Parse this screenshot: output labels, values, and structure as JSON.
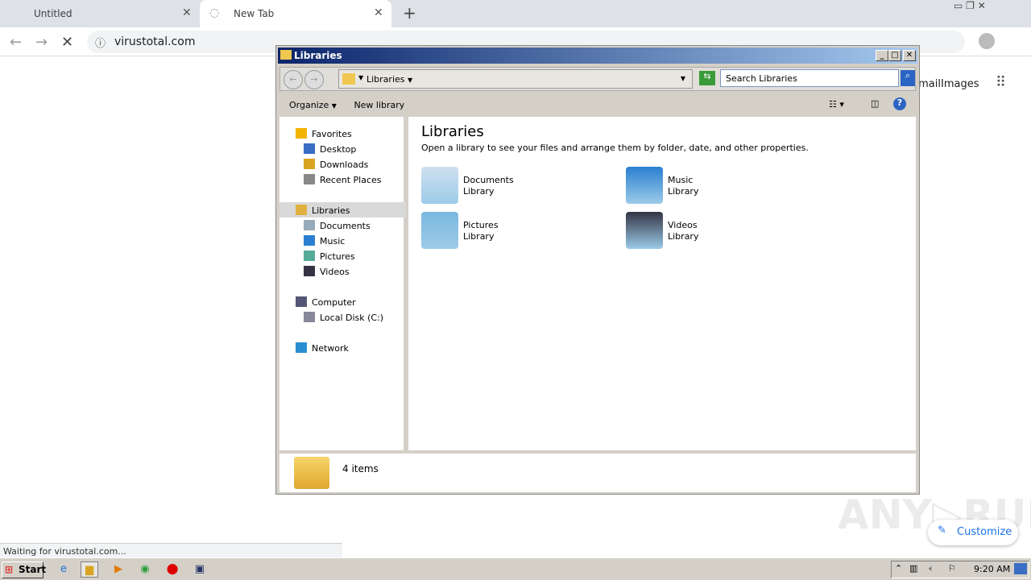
{
  "browser": {
    "tabs": [
      {
        "label": "Untitled"
      },
      {
        "label": "New Tab"
      }
    ],
    "url": "virustotal.com",
    "status": "Waiting for virustotal.com...",
    "google_links": [
      "Gmail",
      "Images"
    ],
    "customize": "Customize"
  },
  "explorer": {
    "title": "Libraries",
    "breadcrumb": "Libraries",
    "search_placeholder": "Search Libraries",
    "organize": "Organize",
    "new_library": "New library",
    "nav": [
      {
        "label": "Favorites",
        "icon": "star-icon",
        "indent": 0
      },
      {
        "label": "Desktop",
        "icon": "desktop-icon",
        "indent": 1
      },
      {
        "label": "Downloads",
        "icon": "downloads-icon",
        "indent": 1
      },
      {
        "label": "Recent Places",
        "icon": "recent-places-icon",
        "indent": 1
      },
      {
        "label": "Libraries",
        "icon": "library-icon",
        "indent": 0,
        "selected": true
      },
      {
        "label": "Documents",
        "icon": "documents-icon",
        "indent": 1
      },
      {
        "label": "Music",
        "icon": "music-icon",
        "indent": 1
      },
      {
        "label": "Pictures",
        "icon": "pictures-icon",
        "indent": 1
      },
      {
        "label": "Videos",
        "icon": "videos-icon",
        "indent": 1
      },
      {
        "label": "Computer",
        "icon": "computer-icon",
        "indent": 0
      },
      {
        "label": "Local Disk (C:)",
        "icon": "disk-icon",
        "indent": 1
      },
      {
        "label": "Network",
        "icon": "network-icon",
        "indent": 0
      }
    ],
    "heading": "Libraries",
    "subheading": "Open a library to see your files and arrange them by folder, date, and other properties.",
    "libraries": [
      {
        "name": "Documents",
        "type": "Library"
      },
      {
        "name": "Music",
        "type": "Library"
      },
      {
        "name": "Pictures",
        "type": "Library"
      },
      {
        "name": "Videos",
        "type": "Library"
      }
    ],
    "item_count": "4 items"
  },
  "taskbar": {
    "start": "Start",
    "clock": "9:20 AM"
  },
  "watermark": "ANY RUN"
}
